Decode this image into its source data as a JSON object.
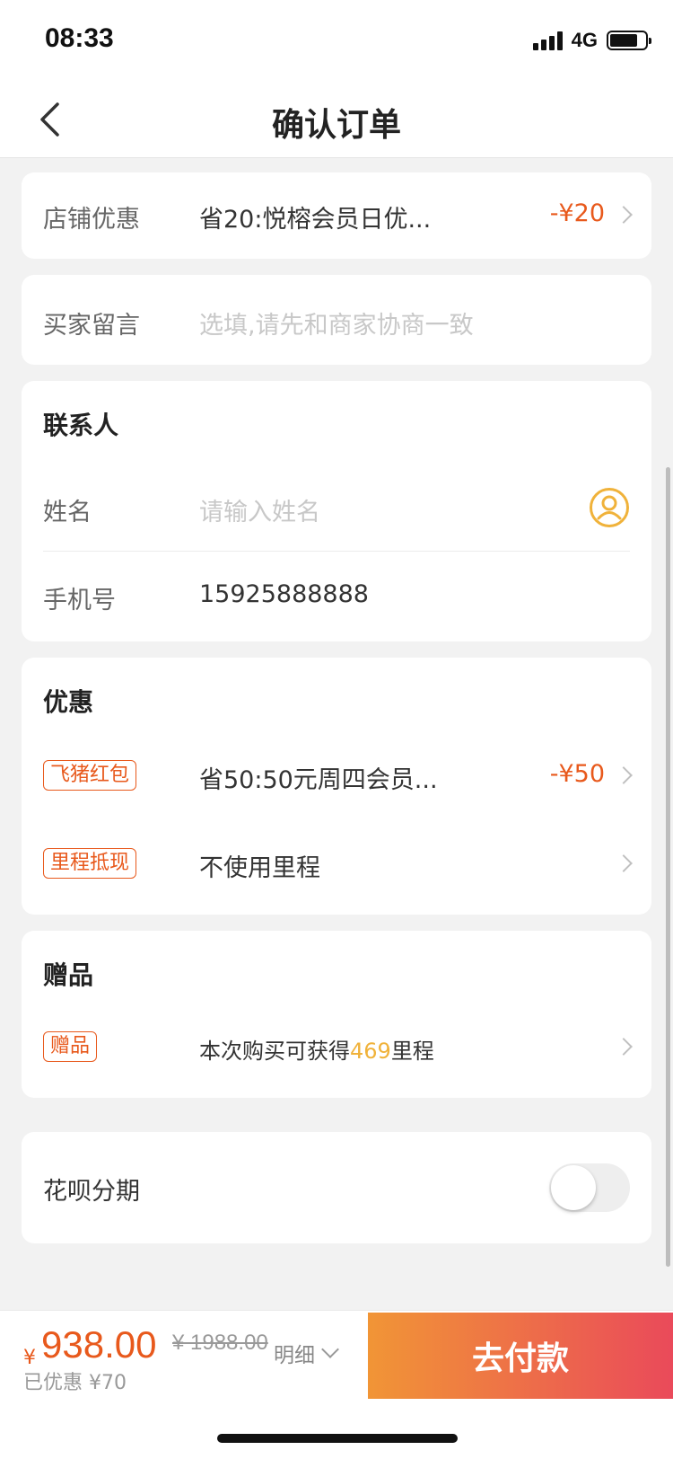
{
  "status_bar": {
    "time": "08:33",
    "network": "4G"
  },
  "nav": {
    "title": "确认订单"
  },
  "store_discount": {
    "label": "店铺优惠",
    "value": "省20:悦榕会员日优...",
    "amount": "-¥20"
  },
  "buyer_message": {
    "label": "买家留言",
    "placeholder": "选填,请先和商家协商一致"
  },
  "contact": {
    "title": "联系人",
    "name_label": "姓名",
    "name_placeholder": "请输入姓名",
    "phone_label": "手机号",
    "phone_value": "15925888888"
  },
  "discounts": {
    "title": "优惠",
    "items": [
      {
        "tag": "飞猪红包",
        "value": "省50:50元周四会员...",
        "amount": "-¥50"
      },
      {
        "tag": "里程抵现",
        "value": "不使用里程",
        "amount": ""
      }
    ]
  },
  "gift": {
    "title": "赠品",
    "tag": "赠品",
    "text_before": "本次购买可获得",
    "miles": "469",
    "text_after": "里程"
  },
  "installment": {
    "label": "花呗分期",
    "enabled": false
  },
  "bottom": {
    "currency": "¥",
    "total": "938.00",
    "original": "¥ 1988.00",
    "saved": "已优惠 ¥70",
    "detail_label": "明细",
    "pay_label": "去付款"
  },
  "colors": {
    "accent": "#e8591c",
    "miles": "#f0b23a",
    "pay_start": "#f19536",
    "pay_end": "#ea4a5a"
  }
}
